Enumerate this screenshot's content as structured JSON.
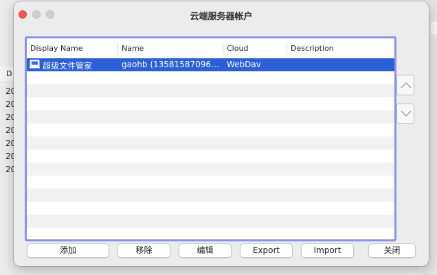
{
  "background_app": {
    "header_label": "D",
    "row_prefix": "20"
  },
  "dialog": {
    "title": "云端服务器帐户",
    "table": {
      "columns": [
        "Display Name",
        "Name",
        "Cloud",
        "Description"
      ],
      "rows": [
        {
          "display_name": "超级文件管家",
          "name": "gaohb (13581587096…",
          "cloud": "WebDav",
          "description": "",
          "selected": true
        }
      ]
    },
    "side_buttons": {
      "up": "chevron-up-icon",
      "down": "chevron-down-icon"
    },
    "buttons": {
      "add": "添加",
      "remove": "移除",
      "edit": "编辑",
      "export": "Export",
      "import": "Import",
      "close": "关闭"
    }
  },
  "colors": {
    "selection": "#2a5fd6",
    "focus_ring": "#8a93e6",
    "close_traffic": "#ee5a52"
  }
}
